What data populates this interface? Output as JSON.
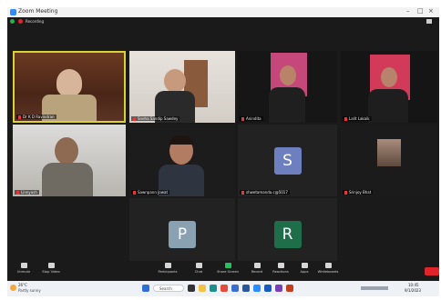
{
  "window": {
    "title": "Zoom Meeting"
  },
  "infobar": {
    "status": "Recording"
  },
  "participants": [
    {
      "name": "Dr K D Ravindran"
    },
    {
      "name": "Sneha Sandip Sawdey"
    },
    {
      "name": "Anindita"
    },
    {
      "name": "Lalit Lakaik"
    },
    {
      "name": "Linnyash"
    },
    {
      "name": "Sawnpann Jowat"
    },
    {
      "name": "shwetamanda.c@5017",
      "initial": "S"
    },
    {
      "name": "Srinjoy Bhat"
    },
    {
      "name": "PBN BUSINESS SCHOOL",
      "initial": "P"
    },
    {
      "name": "Bhawana Mukherjee",
      "initial": "R"
    }
  ],
  "toolbar": {
    "items": [
      {
        "label": "Unmute",
        "icon": "mic-icon"
      },
      {
        "label": "Stop Video",
        "icon": "video-icon"
      },
      {
        "label": "Participants",
        "icon": "participants-icon"
      },
      {
        "label": "Chat",
        "icon": "chat-icon"
      },
      {
        "label": "Share Screen",
        "icon": "share-screen-icon"
      },
      {
        "label": "Record",
        "icon": "record-icon"
      },
      {
        "label": "Reactions",
        "icon": "reactions-icon"
      },
      {
        "label": "Apps",
        "icon": "apps-icon"
      },
      {
        "label": "Whiteboards",
        "icon": "whiteboard-icon"
      }
    ],
    "colors": {
      "share": "#23c15c",
      "end": "#e0242a"
    }
  },
  "taskbar": {
    "weather_temp": "26°C",
    "weather_desc": "Partly sunny",
    "search": "Search",
    "time": "10:45",
    "date": "9/1/2023"
  }
}
